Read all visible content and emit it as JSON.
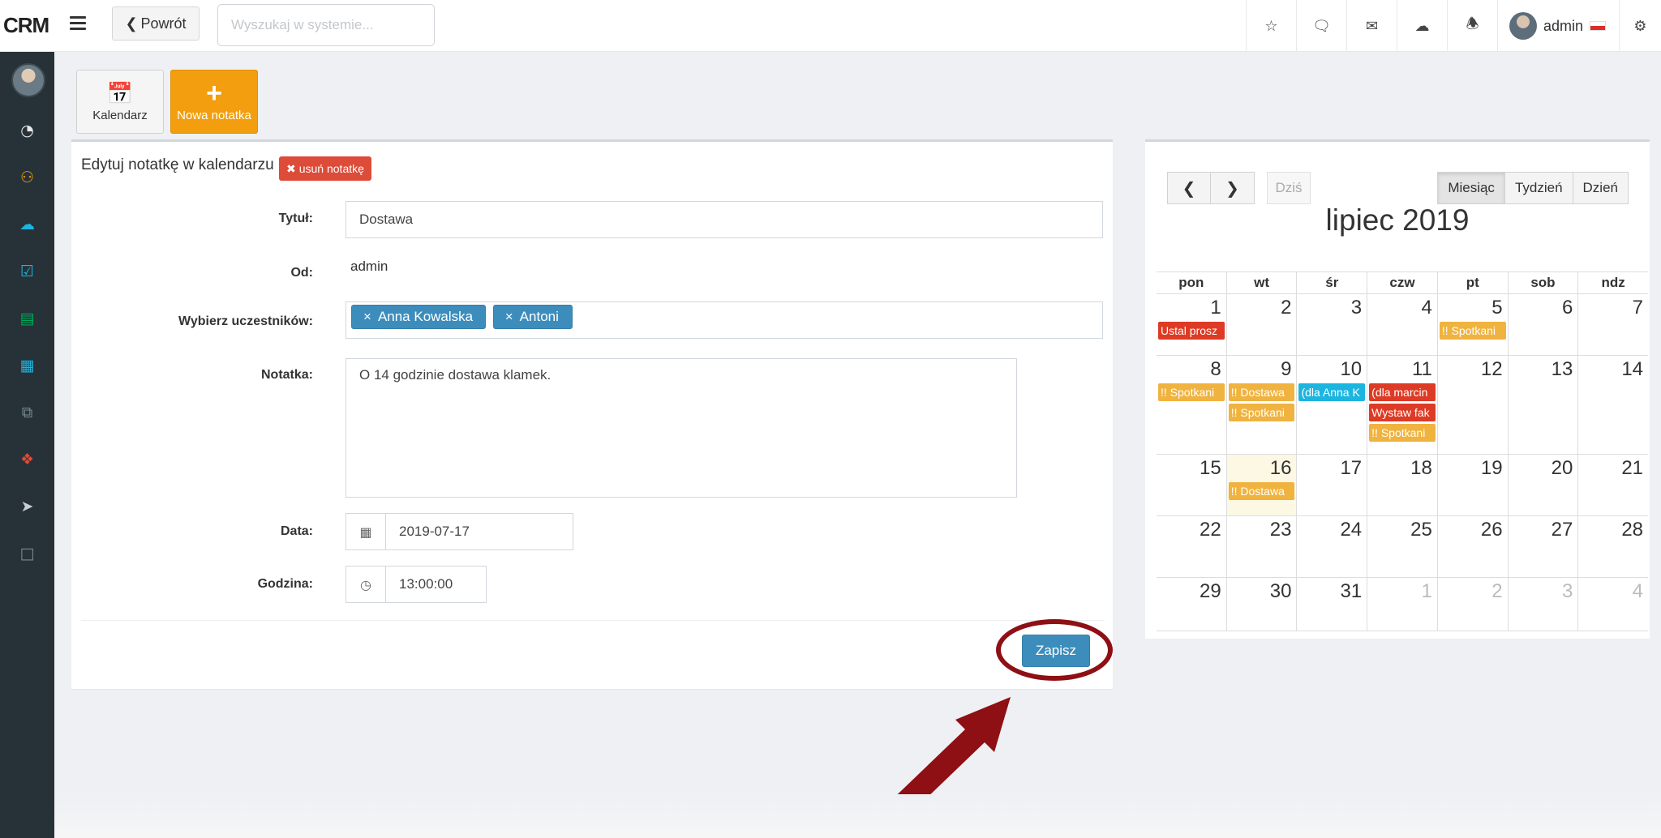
{
  "app": {
    "logo": "CRM"
  },
  "topbar": {
    "back_label": "Powrót",
    "search_placeholder": "Wyszukaj w systemie...",
    "user_name": "admin"
  },
  "toolbar": {
    "calendar_label": "Kalendarz",
    "new_note_label": "Nowa notatka"
  },
  "form": {
    "title": "Edytuj notatkę w kalendarzu",
    "delete_label": "usuń notatkę",
    "title_label": "Tytuł:",
    "title_value": "Dostawa",
    "from_label": "Od:",
    "from_value": "admin",
    "participants_label": "Wybierz uczestników:",
    "participants": [
      "Anna Kowalska",
      "Antoni"
    ],
    "note_label": "Notatka:",
    "note_value": "O 14 godzinie dostawa klamek.",
    "date_label": "Data:",
    "date_value": "2019-07-17",
    "time_label": "Godzina:",
    "time_value": "13:00:00",
    "save_label": "Zapisz"
  },
  "calendar": {
    "title": "lipiec 2019",
    "today_label": "Dziś",
    "views": [
      "Miesiąc",
      "Tydzień",
      "Dzień"
    ],
    "active_view": "Miesiąc",
    "weekdays": [
      "pon",
      "wt",
      "śr",
      "czw",
      "pt",
      "sob",
      "ndz"
    ],
    "weeks": [
      [
        {
          "day": "1",
          "events": [
            {
              "text": "Ustal prosz",
              "color": "red"
            }
          ]
        },
        {
          "day": "2",
          "events": []
        },
        {
          "day": "3",
          "events": []
        },
        {
          "day": "4",
          "events": []
        },
        {
          "day": "5",
          "events": [
            {
              "text": "!! Spotkani",
              "color": "yellow"
            }
          ]
        },
        {
          "day": "6",
          "events": []
        },
        {
          "day": "7",
          "events": []
        }
      ],
      [
        {
          "day": "8",
          "events": [
            {
              "text": "!! Spotkani",
              "color": "yellow"
            }
          ]
        },
        {
          "day": "9",
          "events": [
            {
              "text": "!! Dostawa",
              "color": "yellow"
            },
            {
              "text": "!! Spotkani",
              "color": "yellow"
            }
          ]
        },
        {
          "day": "10",
          "events": [
            {
              "text": "(dla Anna K",
              "color": "blue"
            }
          ]
        },
        {
          "day": "11",
          "events": [
            {
              "text": "(dla marcin",
              "color": "red"
            },
            {
              "text": "Wystaw fak",
              "color": "red"
            },
            {
              "text": "!! Spotkani",
              "color": "yellow"
            }
          ]
        },
        {
          "day": "12",
          "events": []
        },
        {
          "day": "13",
          "events": []
        },
        {
          "day": "14",
          "events": []
        }
      ],
      [
        {
          "day": "15",
          "events": []
        },
        {
          "day": "16",
          "today": true,
          "events": [
            {
              "text": "!! Dostawa",
              "color": "yellow"
            }
          ]
        },
        {
          "day": "17",
          "events": []
        },
        {
          "day": "18",
          "events": []
        },
        {
          "day": "19",
          "events": []
        },
        {
          "day": "20",
          "events": []
        },
        {
          "day": "21",
          "events": []
        }
      ],
      [
        {
          "day": "22",
          "events": []
        },
        {
          "day": "23",
          "events": []
        },
        {
          "day": "24",
          "events": []
        },
        {
          "day": "25",
          "events": []
        },
        {
          "day": "26",
          "events": []
        },
        {
          "day": "27",
          "events": []
        },
        {
          "day": "28",
          "events": []
        }
      ],
      [
        {
          "day": "29",
          "events": []
        },
        {
          "day": "30",
          "events": []
        },
        {
          "day": "31",
          "events": []
        },
        {
          "day": "1",
          "other": true,
          "events": []
        },
        {
          "day": "2",
          "other": true,
          "events": []
        },
        {
          "day": "3",
          "other": true,
          "events": []
        },
        {
          "day": "4",
          "other": true,
          "events": []
        }
      ]
    ]
  },
  "colors": {
    "sidebar": "#263238",
    "primary": "#3c8dbc",
    "warning": "#f29e0f",
    "danger": "#dd4b39",
    "annotation": "#8e0f14"
  }
}
